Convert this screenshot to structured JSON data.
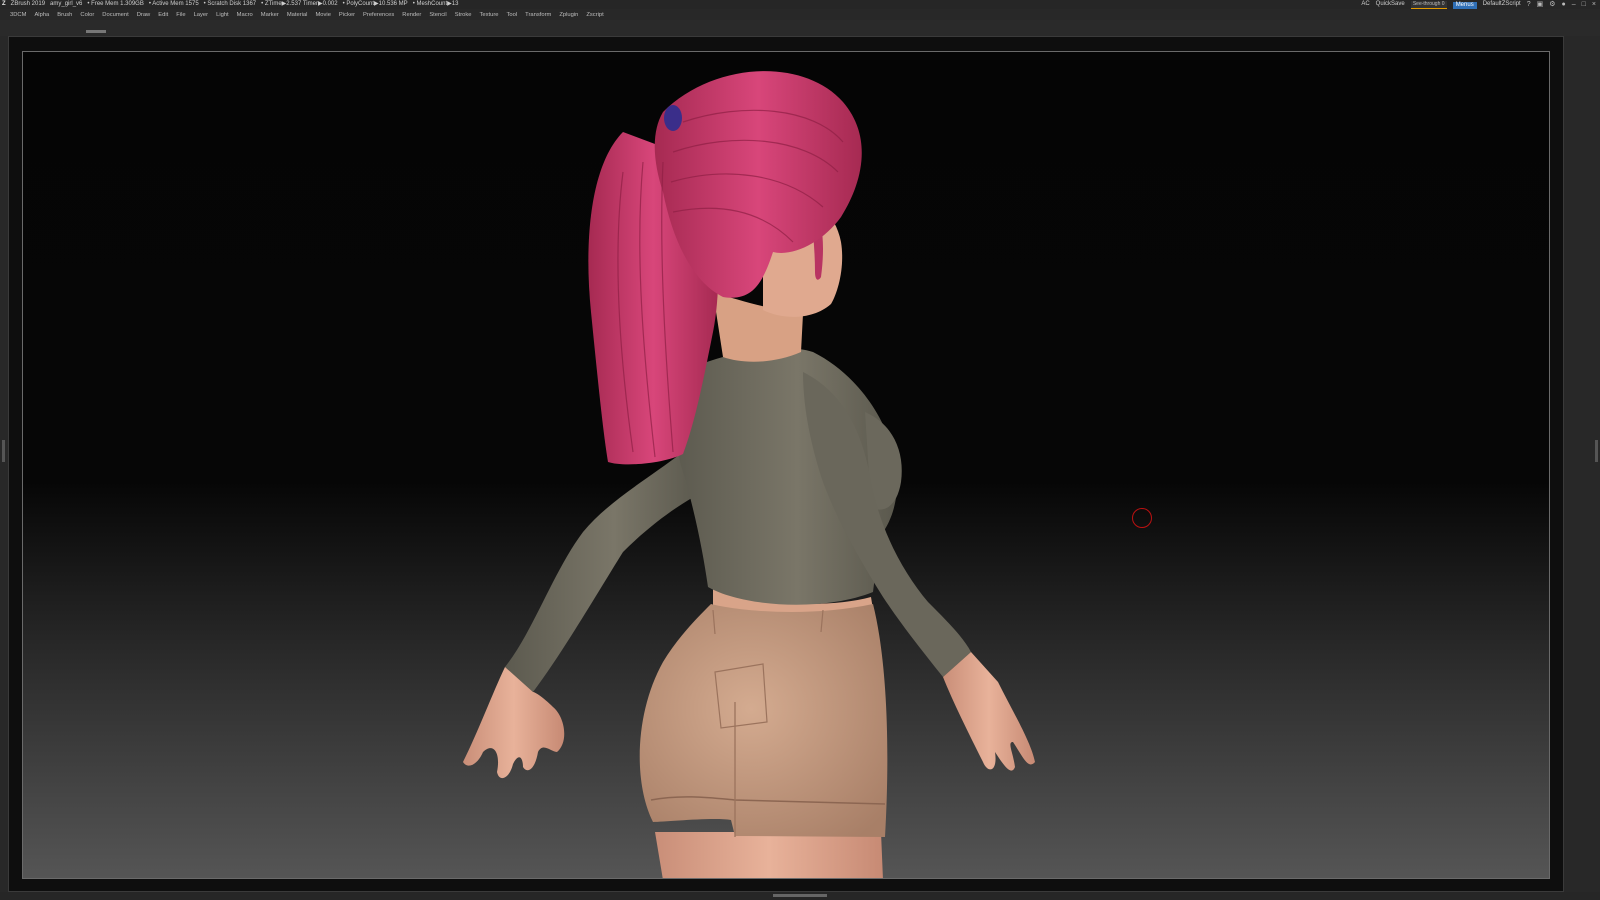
{
  "titlebar": {
    "app_name": "ZBrush 2019",
    "file_name": "amy_girl_v6",
    "free_mem": "• Free Mem 1.309GB",
    "active_mem": "• Active Mem 1575",
    "scratch_disk": "• Scratch Disk 1367",
    "ztime": "• ZTime▶2.537 Timer▶0.002",
    "polycount": "• PolyCount▶10.536 MP",
    "meshcount": "• MeshCount▶13",
    "ac_label": "AC",
    "quicksave_label": "QuickSave",
    "see_through_label": "See-through",
    "see_through_value": "0",
    "menus_label": "Menus",
    "default_script": "DefaultZScript"
  },
  "menubar": {
    "items": [
      "3DCM",
      "Alpha",
      "Brush",
      "Color",
      "Document",
      "Draw",
      "Edit",
      "File",
      "Layer",
      "Light",
      "Macro",
      "Marker",
      "Material",
      "Movie",
      "Picker",
      "Preferences",
      "Render",
      "Stencil",
      "Stroke",
      "Texture",
      "Tool",
      "Transform",
      "Zplugin",
      "Zscript"
    ]
  },
  "colors": {
    "hair": "#c83a68",
    "skin": "#e0a890",
    "shirt": "#6f6c5f",
    "shorts": "#c49a80",
    "hair_tie": "#3a2e8a",
    "cursor": "#bb1111",
    "ui_accent": "#2f6fb6",
    "slider_accent": "#e29a00"
  },
  "scene": {
    "see_through_level": 0
  }
}
